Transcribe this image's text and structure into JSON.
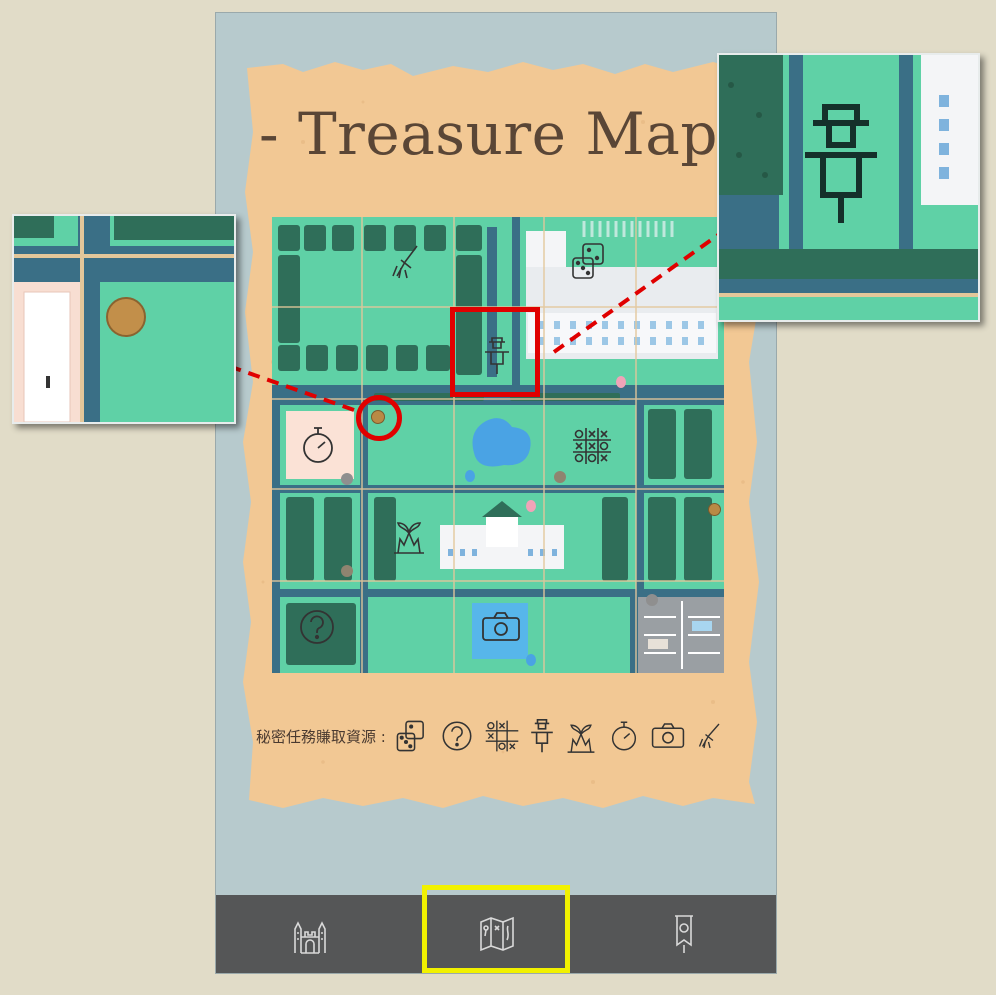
{
  "map": {
    "title": "- Treasure Map -"
  },
  "legend": {
    "label": "秘密任務賺取資源 :",
    "icons": [
      "dice-icon",
      "question-icon",
      "tic-tac-toe-icon",
      "scarecrow-icon",
      "plant-icon",
      "stopwatch-icon",
      "camera-icon",
      "broom-icon"
    ]
  },
  "nav": {
    "items": [
      "castle-icon",
      "map-icon",
      "banner-icon"
    ],
    "active": "map-icon"
  },
  "colors": {
    "frame_bg": "#b7cacd",
    "parchment": "#f2c894",
    "map_green": "#5fd1a6",
    "map_road": "#3a6f86",
    "hedge": "#2f6e59",
    "highlight_red": "#e00000",
    "highlight_yellow": "#f1f100",
    "bottom_bar": "#555657"
  }
}
